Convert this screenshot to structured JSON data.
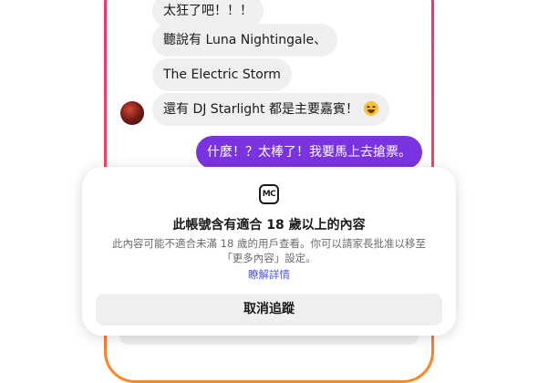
{
  "chat": {
    "messages": [
      {
        "text": "太狂了吧！！！"
      },
      {
        "text": "聽說有 Luna Nightingale、"
      },
      {
        "text": "The Electric Storm"
      },
      {
        "text": "還有 DJ Starlight 都是主要嘉賓！"
      }
    ],
    "emoji": "star-struck-emoji",
    "outgoing": {
      "text": "什麼！？太棒了！我要馬上去搶票。"
    }
  },
  "background": {
    "button_label": "取消追蹤"
  },
  "sheet": {
    "icon": "mc-icon",
    "icon_text": "MC",
    "title": "此帳號含有適合 18 歲以上的內容",
    "description": "此內容可能不適合未滿 18 歲的用戶查看。你可以請家長批准以移至「更多內容」設定。",
    "link": "瞭解詳情",
    "button_label": "取消追蹤"
  },
  "colors": {
    "outgoing_bubble": "#7a33e0",
    "incoming_bubble": "#efeff1",
    "link": "#4a53f0",
    "frame_gradient_top": "#ff2a6d",
    "frame_gradient_bottom": "#ff8a1f"
  }
}
